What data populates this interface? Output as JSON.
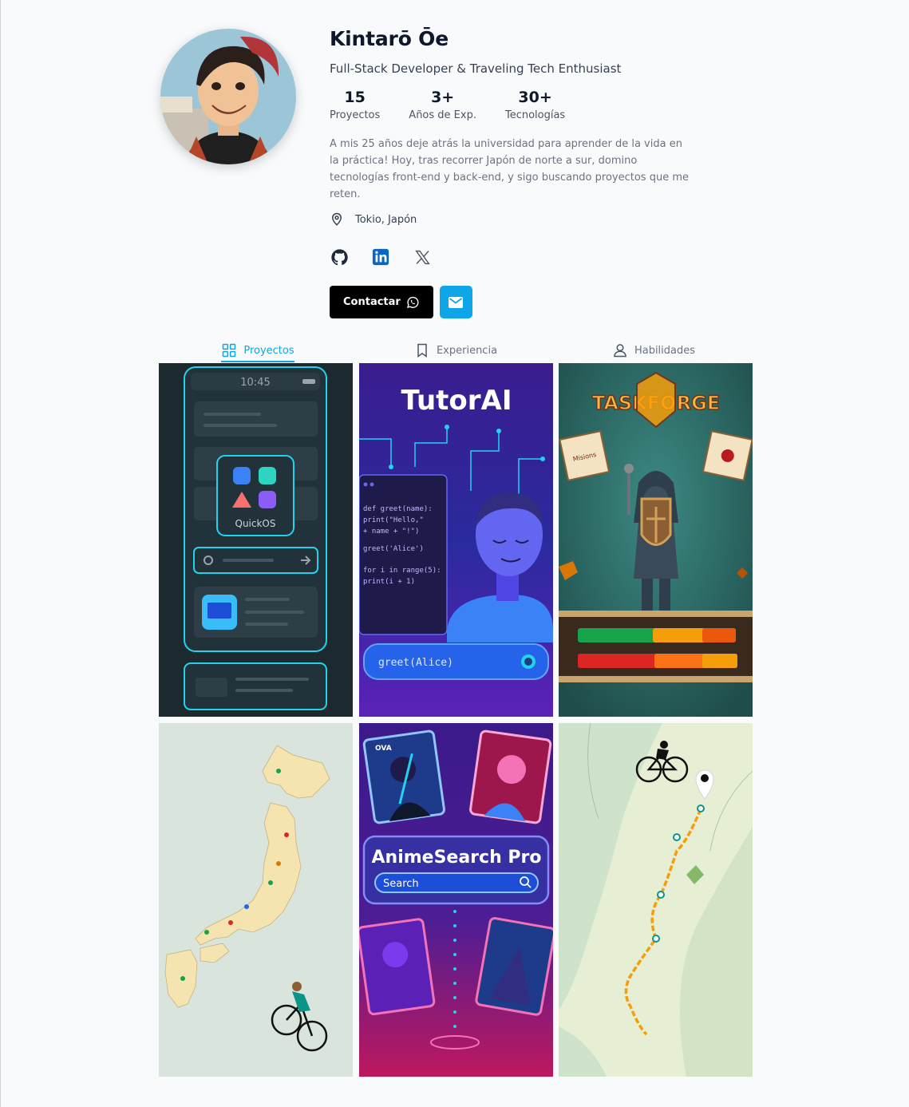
{
  "profile": {
    "name": "Kintarō Ōe",
    "tagline": "Full-Stack Developer & Traveling Tech Enthusiast",
    "stats": [
      {
        "value": "15",
        "label": "Proyectos"
      },
      {
        "value": "3+",
        "label": "Años de Exp."
      },
      {
        "value": "30+",
        "label": "Tecnologías"
      }
    ],
    "bio": "A mis 25 años deje atrás la universidad para aprender de la vida en la práctica! Hoy, tras recorrer Japón de norte a sur, domino tecnologías front-end y back-end, y sigo buscando proyectos que me reten.",
    "location": "Tokio, Japón"
  },
  "socials": [
    {
      "icon": "github-icon"
    },
    {
      "icon": "linkedin-icon"
    },
    {
      "icon": "x-icon"
    }
  ],
  "actions": {
    "contact_label": "Contactar",
    "contact_icon": "whatsapp-icon",
    "mail_icon": "mail-icon"
  },
  "tabs": [
    {
      "label": "Proyectos",
      "icon": "grid-icon",
      "active": true
    },
    {
      "label": "Experiencia",
      "icon": "bookmark-icon",
      "active": false
    },
    {
      "label": "Habilidades",
      "icon": "user-icon",
      "active": false
    }
  ],
  "projects": [
    {
      "title": "QuickOS",
      "time": "10:45"
    },
    {
      "title": "TutorAI",
      "code": [
        "def greet(name):",
        "  print(\"Hello,\"",
        "    + name + \"!\")",
        "greet('Alice')",
        "for i in range(5):",
        "  print(i + 1)"
      ],
      "input": "greet(Alice)"
    },
    {
      "title": "TASKFORGE",
      "sign": "Misions"
    },
    {
      "title": "Japan Map"
    },
    {
      "title": "AnimeSearch Pro",
      "search": "Search",
      "badge": "OVA"
    },
    {
      "title": "Cycling Route"
    }
  ],
  "colors": {
    "accent": "#0ea5e9",
    "linkedin": "#0a66c2",
    "text_dark": "#111827"
  }
}
